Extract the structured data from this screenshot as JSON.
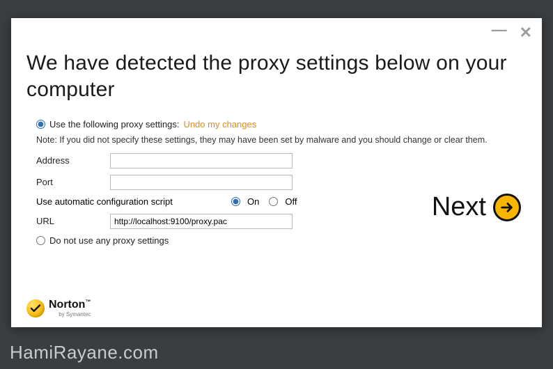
{
  "window": {
    "minimize_glyph": "—",
    "close_glyph": "✕"
  },
  "heading": "We have detected the proxy settings below on your computer",
  "radio_use": {
    "label": "Use the following proxy settings:",
    "checked": true
  },
  "undo_link": "Undo my changes",
  "note": "Note: If you did not specify these settings, they may have been set by malware and you should change or clear them.",
  "fields": {
    "address": {
      "label": "Address",
      "value": ""
    },
    "port": {
      "label": "Port",
      "value": ""
    },
    "url": {
      "label": "URL",
      "value": "http://localhost:9100/proxy.pac"
    }
  },
  "autoscript": {
    "label": "Use automatic configuration script",
    "on_label": "On",
    "off_label": "Off",
    "value": "on"
  },
  "radio_none": {
    "label": "Do not use any proxy settings",
    "checked": false
  },
  "brand": {
    "name": "Norton",
    "tm": "™",
    "byline": "by Symantec"
  },
  "next_label": "Next",
  "watermark": "HamiRayane.com",
  "colors": {
    "accent_orange": "#e08b1f",
    "brand_yellow": "#f7b500",
    "background": "#3a3e40"
  }
}
